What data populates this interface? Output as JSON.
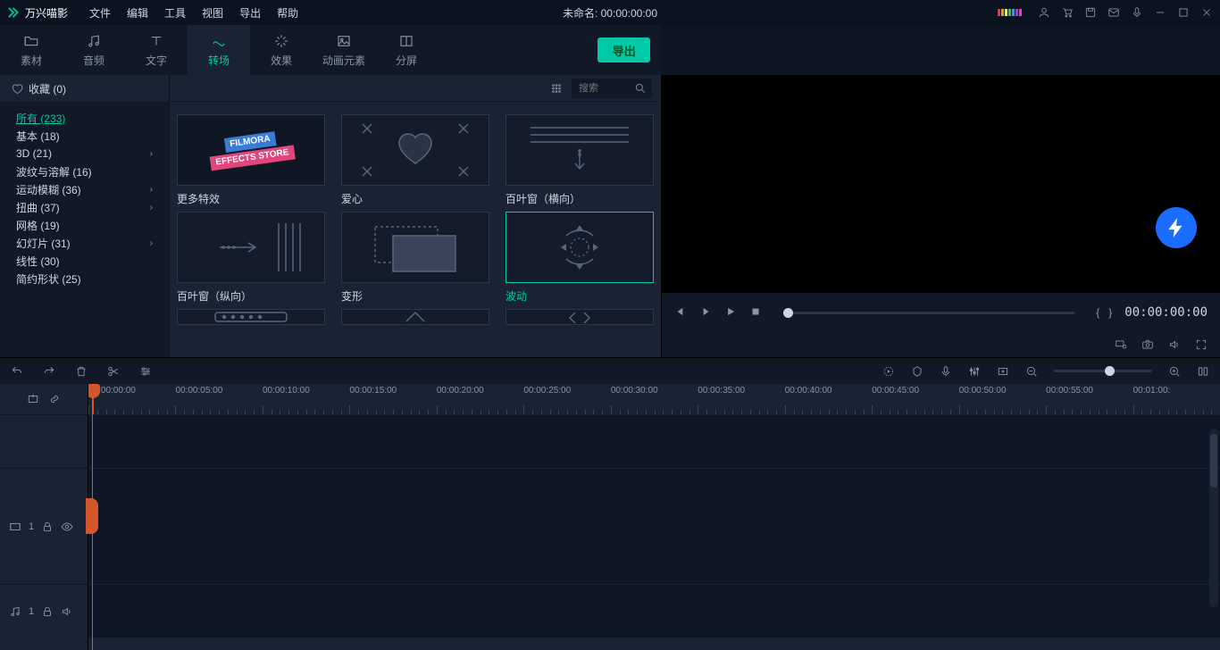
{
  "app": {
    "name": "万兴喵影"
  },
  "menu": [
    "文件",
    "编辑",
    "工具",
    "视图",
    "导出",
    "帮助"
  ],
  "document": {
    "title_prefix": "未命名: ",
    "timecode": "00:00:00:00"
  },
  "tabs": [
    {
      "id": "media",
      "label": "素材"
    },
    {
      "id": "audio",
      "label": "音频"
    },
    {
      "id": "text",
      "label": "文字"
    },
    {
      "id": "transition",
      "label": "转场",
      "active": true
    },
    {
      "id": "effect",
      "label": "效果"
    },
    {
      "id": "motion",
      "label": "动画元素"
    },
    {
      "id": "split",
      "label": "分屏"
    }
  ],
  "export_label": "导出",
  "favorites": {
    "label": "收藏",
    "count": 0
  },
  "categories": [
    {
      "label": "所有",
      "count": 233,
      "selected": true,
      "expand": false
    },
    {
      "label": "基本",
      "count": 18,
      "expand": false
    },
    {
      "label": "3D",
      "count": 21,
      "expand": true
    },
    {
      "label": "波纹与溶解",
      "count": 16,
      "expand": false
    },
    {
      "label": "运动模糊",
      "count": 36,
      "expand": true
    },
    {
      "label": "扭曲",
      "count": 37,
      "expand": true
    },
    {
      "label": "网格",
      "count": 19,
      "expand": false
    },
    {
      "label": "幻灯片",
      "count": 31,
      "expand": true
    },
    {
      "label": "线性",
      "count": 30,
      "expand": false
    },
    {
      "label": "简约形状",
      "count": 25,
      "expand": false
    }
  ],
  "search": {
    "placeholder": "搜索"
  },
  "effects": [
    {
      "id": "store",
      "label": "更多特效"
    },
    {
      "id": "heart",
      "label": "爱心"
    },
    {
      "id": "blinds-h",
      "label": "百叶窗（横向）"
    },
    {
      "id": "blinds-v",
      "label": "百叶窗（纵向）"
    },
    {
      "id": "warp",
      "label": "变形"
    },
    {
      "id": "wave",
      "label": "波动",
      "selected": true
    }
  ],
  "preview": {
    "timecode": "00:00:00:00"
  },
  "ruler": {
    "labels": [
      "00:00:00:00",
      "00:00:05:00",
      "00:00:10:00",
      "00:00:15:00",
      "00:00:20:00",
      "00:00:25:00",
      "00:00:30:00",
      "00:00:35:00",
      "00:00:40:00",
      "00:00:45:00",
      "00:00:50:00",
      "00:00:55:00",
      "00:01:00:"
    ]
  },
  "tracks": {
    "video": {
      "index": "1"
    },
    "audio": {
      "index": "1"
    }
  },
  "colorbars": [
    "#e33",
    "#f90",
    "#ee3",
    "#3c3",
    "#39f",
    "#93f",
    "#f3c"
  ]
}
